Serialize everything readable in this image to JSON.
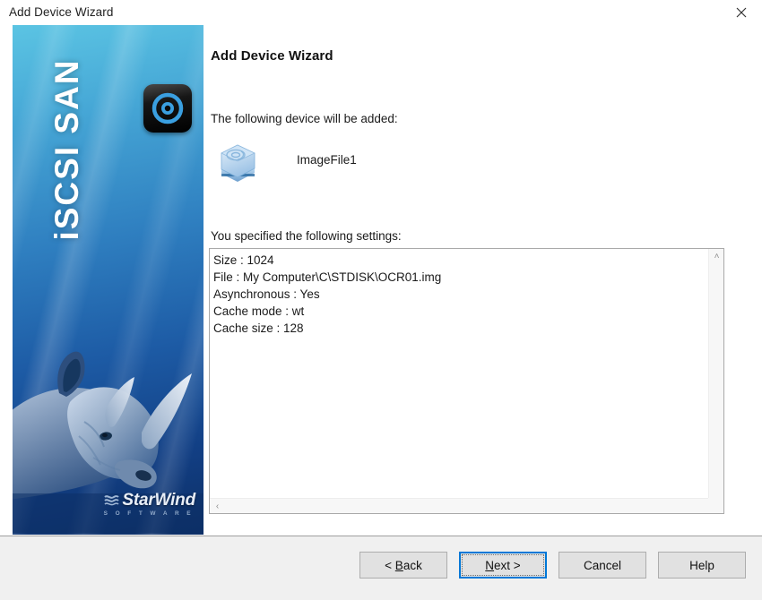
{
  "window": {
    "title": "Add Device Wizard",
    "close_icon": "close-icon"
  },
  "banner": {
    "vertical_title": "iSCSI SAN",
    "app_icon_name": "starwind-target-icon",
    "illustration": "rhinoceros-illustration",
    "logo_main": "StarWind",
    "logo_sub": "S O F T W A R E",
    "logo_wave_icon": "wave-logo-icon",
    "colors": {
      "top": "#5bc4e3",
      "mid": "#2f7fc0",
      "bottom": "#0d2f66"
    }
  },
  "content": {
    "heading": "Add Device Wizard",
    "device_intro_label": "The following device will be added:",
    "device_icon_name": "hard-disk-icon",
    "device_name": "ImageFile1",
    "settings_label": "You specified the following settings:",
    "settings_lines": [
      "Size : 1024",
      "File : My Computer\\C\\STDISK\\OCR01.img",
      "Asynchronous : Yes",
      "Cache mode : wt",
      "Cache size : 128"
    ],
    "settings_text": "Size : 1024\nFile : My Computer\\C\\STDISK\\OCR01.img\nAsynchronous : Yes\nCache mode : wt\nCache size : 128",
    "scroll": {
      "up_arrow": "˄",
      "down_arrow": "˅",
      "left_arrow": "‹",
      "right_arrow": "›"
    }
  },
  "footer": {
    "buttons": [
      {
        "id": "back",
        "label": "< Back",
        "accel_prefix": "< ",
        "accel_char": "B",
        "accel_suffix": "ack",
        "default": false
      },
      {
        "id": "next",
        "label": "Next >",
        "accel_prefix": "",
        "accel_char": "N",
        "accel_suffix": "ext >",
        "default": true
      },
      {
        "id": "cancel",
        "label": "Cancel",
        "accel_prefix": "",
        "accel_char": "",
        "accel_suffix": "Cancel",
        "default": false
      },
      {
        "id": "help",
        "label": "Help",
        "accel_prefix": "",
        "accel_char": "",
        "accel_suffix": "Help",
        "default": false
      }
    ],
    "accent_color": "#0078d7"
  }
}
